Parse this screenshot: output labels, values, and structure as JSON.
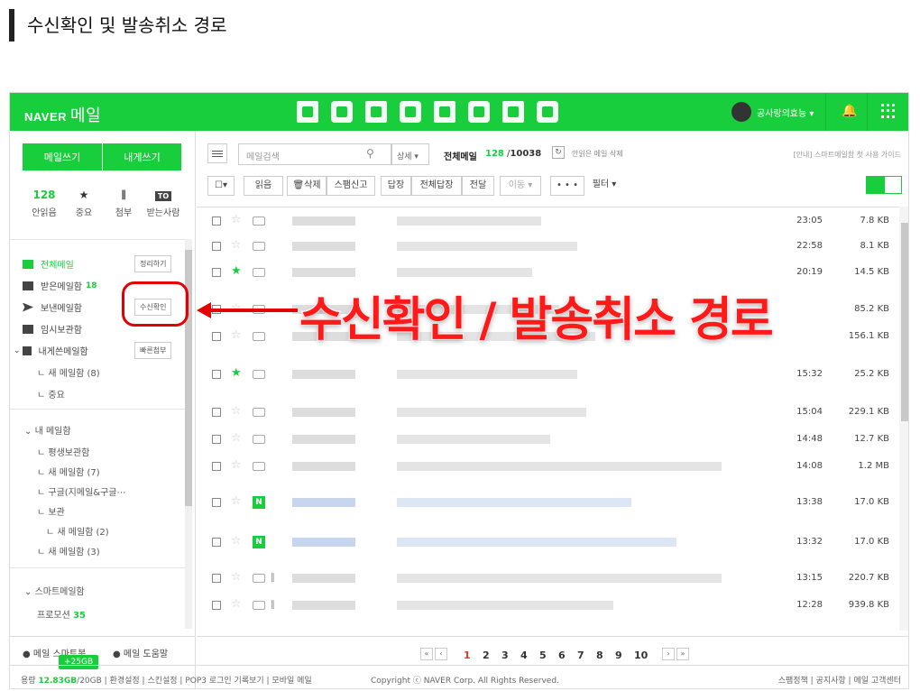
{
  "page_heading": "수신확인 및 발송취소 경로",
  "colors": {
    "brand": "#19ce3c",
    "annotation": "#e20000"
  },
  "app": {
    "logo_en": "NAVER",
    "logo_ko": "메일",
    "user_name": "공사랑의효능 ▾",
    "top_icons": [
      "mail-icon",
      "calendar-icon",
      "list-icon",
      "contacts-icon",
      "blog-icon",
      "office-icon",
      "cafe-icon",
      "memo-icon"
    ]
  },
  "sidebar": {
    "write_btn": "메일쓰기",
    "self_write_btn": "내게쓰기",
    "quick": [
      {
        "top": "128",
        "label": "안읽음"
      },
      {
        "top": "★",
        "label": "중요"
      },
      {
        "top": "📎",
        "label": "첨부"
      },
      {
        "top": "TO",
        "label": "받는사람"
      }
    ],
    "all_mail": "전체메일",
    "cleanup_btn": "정리하기",
    "inbox": "받은메일함",
    "inbox_count": "18",
    "sent": "보낸메일함",
    "read_receipt_btn": "수신확인",
    "drafts": "임시보관함",
    "self_box": "내게쓴메일함",
    "quick_attach_btn": "빠른첨부",
    "sub1": "ㄴ 새 메일함 (8)",
    "sub2": "ㄴ 중요",
    "my_boxes": "내 메일함",
    "my1": "ㄴ 평생보관함",
    "my2": "ㄴ 새 메일함 (7)",
    "my3": "ㄴ 구글(지메일&구글⋯",
    "my4": "ㄴ 보관",
    "my5": "ㄴ 새 메일함 (2)",
    "my6": "ㄴ 새 메일함 (3)",
    "smart": "스마트메일함",
    "promo": "프로모션",
    "promo_count": "35",
    "foot_smartbot": "메일 스마트봇",
    "foot_help": "메일 도움말",
    "storage_badge": "+25GB"
  },
  "main": {
    "search_placeholder": "메일검색",
    "detail_btn": "상세 ▾",
    "all_label": "전체메일",
    "unread": "128",
    "total": "10038",
    "delete_unread": "안읽은 메일 삭제",
    "guide": "[안내] 스마트메일함 첫 사용 가이드",
    "tb_read": "읽음",
    "tb_delete": "🗑삭제",
    "tb_spam": "스팸신고",
    "tb_reply": "답장",
    "tb_reply_all": "전체답장",
    "tb_forward": "전달",
    "tb_move": "이동 ▾",
    "tb_more": "• • •",
    "tb_filter": "필터 ▾"
  },
  "rows": [
    {
      "time": "23:05",
      "size": "7.8 KB"
    },
    {
      "time": "22:58",
      "size": "8.1 KB"
    },
    {
      "time": "20:19",
      "size": "14.5 KB"
    },
    {
      "time": "",
      "size": "85.2 KB"
    },
    {
      "time": "",
      "size": "156.1 KB"
    },
    {
      "time": "15:32",
      "size": "25.2 KB"
    },
    {
      "time": "15:04",
      "size": "229.1 KB"
    },
    {
      "time": "14:48",
      "size": "12.7 KB"
    },
    {
      "time": "14:08",
      "size": "1.2 MB"
    },
    {
      "time": "13:38",
      "size": "17.0 KB"
    },
    {
      "time": "13:32",
      "size": "17.0 KB"
    },
    {
      "time": "13:15",
      "size": "220.7 KB"
    },
    {
      "time": "12:28",
      "size": "939.8 KB"
    }
  ],
  "pager": {
    "pages": [
      "1",
      "2",
      "3",
      "4",
      "5",
      "6",
      "7",
      "8",
      "9",
      "10"
    ],
    "current": "1"
  },
  "footer": {
    "usage_label": "용량",
    "usage": "12.83GB",
    "quota": "/20GB",
    "links": "|  환경설정  |  스킨설정  |  POP3 로그인 기록보기  |  모바일 메일",
    "copyright": "Copyright ⓒ NAVER Corp. All Rights Reserved.",
    "right_links": "스팸정책  |  공지사항  |  메일 고객센터"
  },
  "annotation": "수신확인 / 발송취소 경로"
}
